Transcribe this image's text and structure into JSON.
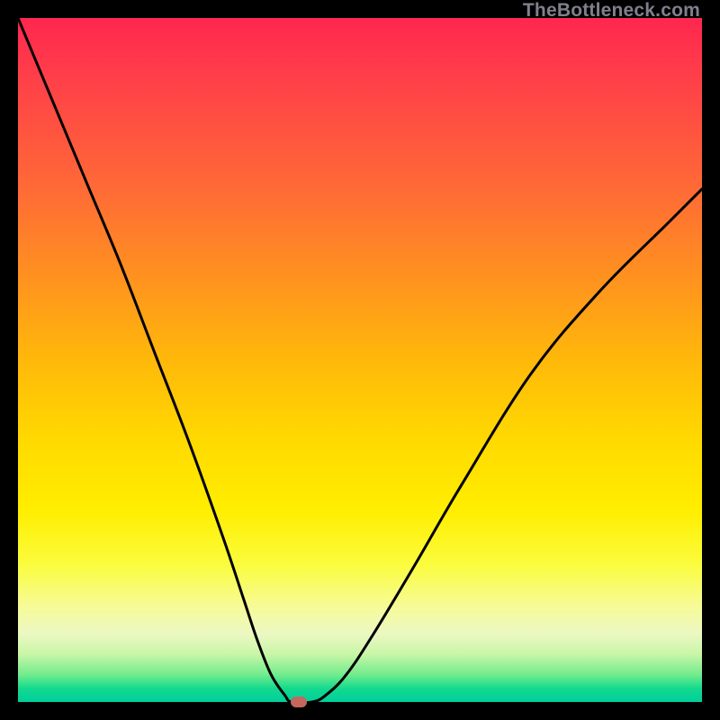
{
  "watermark": "TheBottleneck.com",
  "chart_data": {
    "type": "line",
    "title": "",
    "xlabel": "",
    "ylabel": "",
    "xlim": [
      0,
      100
    ],
    "ylim": [
      0,
      100
    ],
    "grid": false,
    "series": [
      {
        "name": "bottleneck-curve",
        "x": [
          0,
          5,
          10,
          15,
          20,
          25,
          30,
          33,
          35,
          37,
          39,
          40,
          43,
          45,
          48,
          52,
          58,
          65,
          75,
          85,
          95,
          100
        ],
        "values": [
          100,
          88,
          76,
          64,
          51,
          38,
          24,
          15,
          9,
          4,
          1,
          0,
          0,
          1,
          4,
          10,
          20,
          32,
          48,
          60,
          70,
          75
        ]
      }
    ],
    "marker": {
      "x": 41,
      "y": 0,
      "color": "#c6665e"
    },
    "background_gradient": {
      "top": "#ff274e",
      "mid": "#ffda00",
      "bottom": "#00ce9c"
    }
  }
}
